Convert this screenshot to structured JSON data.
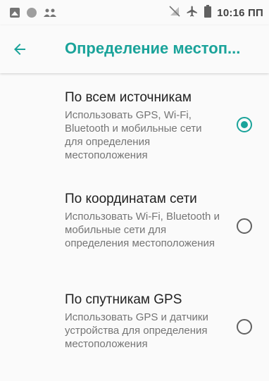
{
  "status_bar": {
    "time": "10:16 ПП",
    "icons": [
      "image-icon",
      "circle-icon",
      "people-icon",
      "no-sim-icon",
      "airplane-icon",
      "battery-icon"
    ]
  },
  "app_bar": {
    "back_icon": "arrow-back-icon",
    "title": "Определение местоп..."
  },
  "options": [
    {
      "title": "По всем источникам",
      "description": "Использовать GPS, Wi-Fi, Bluetooth и мобильные сети для определения местоположения",
      "selected": true
    },
    {
      "title": "По координатам сети",
      "description": "Использовать Wi-Fi, Bluetooth и мобильные сети для определения местоположения",
      "selected": false
    },
    {
      "title": "По спутникам GPS",
      "description": "Использовать GPS и датчики устройства для определения местоположения",
      "selected": false
    }
  ],
  "colors": {
    "accent": "#1aa39a",
    "background": "#fafafa",
    "primary_text": "#212121",
    "secondary_text": "#757575"
  }
}
